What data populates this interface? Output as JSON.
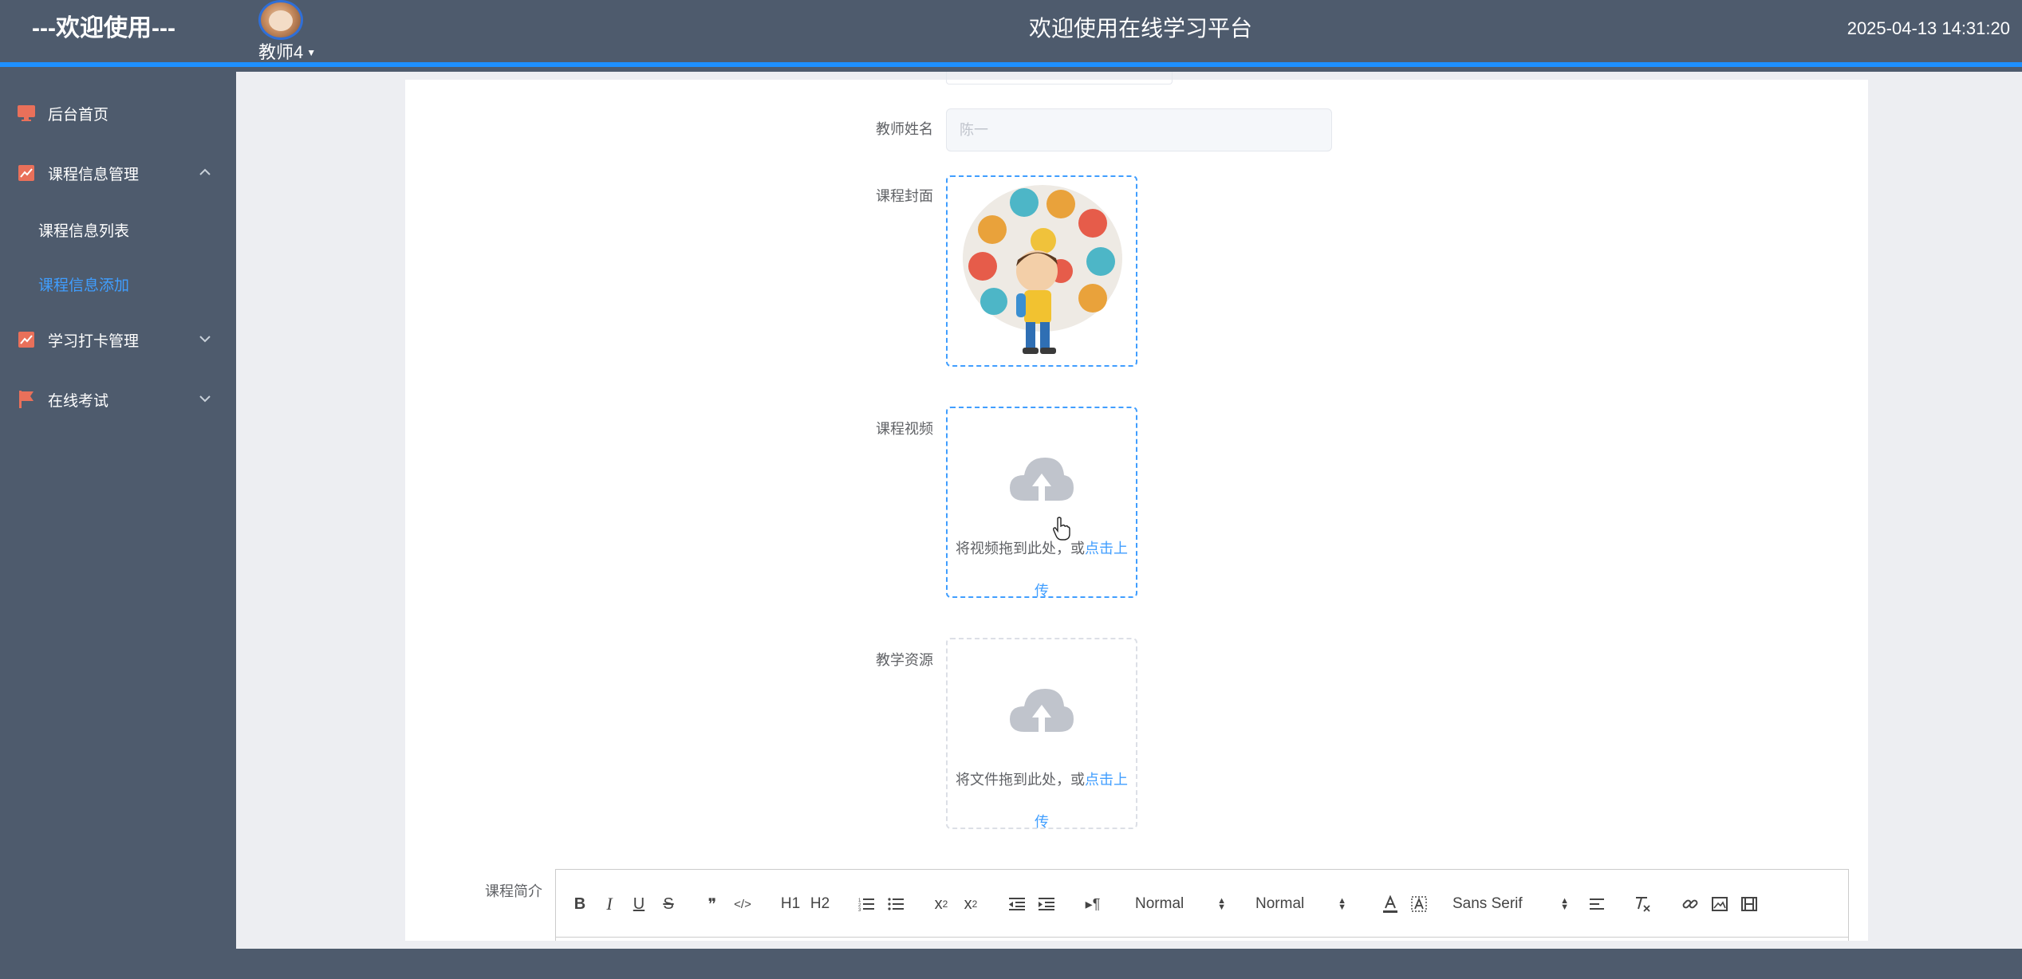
{
  "header": {
    "brand": "---欢迎使用---",
    "user_name": "教师4",
    "title": "欢迎使用在线学习平台",
    "datetime": "2025-04-13 14:31:20",
    "accent_color": "#1e90ff"
  },
  "sidebar": {
    "items": [
      {
        "label": "后台首页",
        "icon": "monitor-icon"
      },
      {
        "label": "课程信息管理",
        "icon": "chart-icon",
        "expanded": true,
        "children": [
          {
            "label": "课程信息列表"
          },
          {
            "label": "课程信息添加",
            "active": true
          }
        ]
      },
      {
        "label": "学习打卡管理",
        "icon": "chart-icon"
      },
      {
        "label": "在线考试",
        "icon": "flag-icon"
      }
    ],
    "active_color": "#409eff",
    "icon_color": "#e9705a"
  },
  "form": {
    "teacher_name": {
      "label": "教师姓名",
      "value": "陈一"
    },
    "cover": {
      "label": "课程封面"
    },
    "video": {
      "label": "课程视频",
      "hint": "将视频拖到此处，或",
      "link_a": "点击上",
      "link_b": "传"
    },
    "resource": {
      "label": "教学资源",
      "hint": "将文件拖到此处，或",
      "link_a": "点击上",
      "link_b": "传"
    },
    "intro": {
      "label": "课程简介"
    }
  },
  "editor": {
    "header_picker": "Normal",
    "size_picker": "Normal",
    "font_picker": "Sans Serif",
    "buttons": {
      "bold": "B",
      "italic": "I",
      "underline": "U",
      "strike": "S",
      "blockquote": "❞",
      "code": "</>",
      "h1": "H1",
      "h2": "H2",
      "subscript": "x",
      "superscript": "x",
      "indent_rtl": "¶"
    }
  }
}
